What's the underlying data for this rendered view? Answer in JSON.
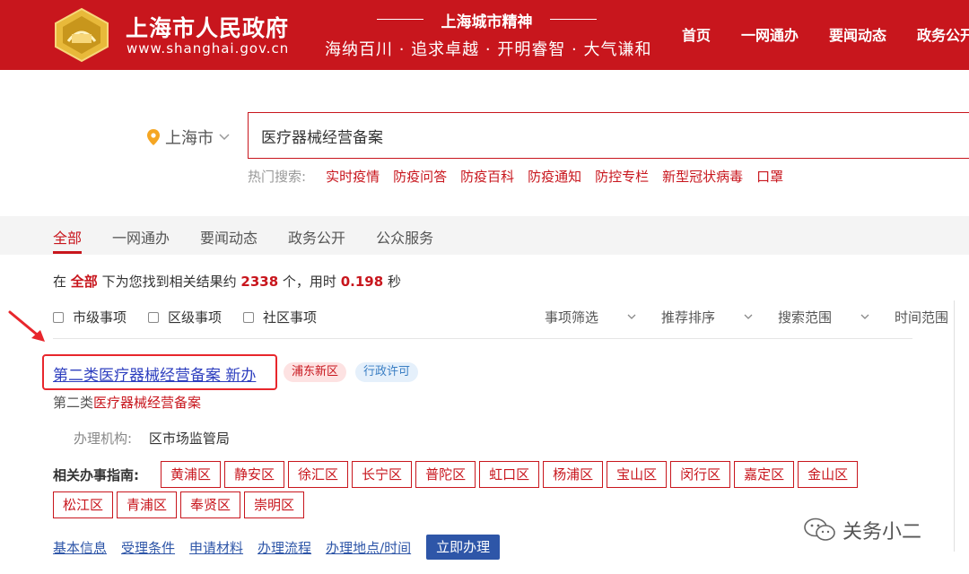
{
  "header": {
    "site_name": "上海市人民政府",
    "site_domain": "www.shanghai.gov.cn",
    "spirit_title": "上海城市精神",
    "spirit_motto": "海纳百川 · 追求卓越 · 开明睿智 · 大气谦和",
    "nav": [
      "首页",
      "一网通办",
      "要闻动态",
      "政务公开"
    ]
  },
  "search": {
    "location": "上海市",
    "query": "医疗器械经营备案",
    "hot_label": "热门搜索:",
    "hot_terms": [
      "实时疫情",
      "防疫问答",
      "防疫百科",
      "防疫通知",
      "防控专栏",
      "新型冠状病毒",
      "口罩"
    ]
  },
  "tabs": [
    "全部",
    "一网通办",
    "要闻动态",
    "政务公开",
    "公众服务"
  ],
  "stats": {
    "prefix": "在",
    "scope": "全部",
    "mid": "下为您找到相关结果约",
    "count": "2338",
    "unit": "个，用时",
    "time": "0.198",
    "suffix": "秒"
  },
  "filters": {
    "checkboxes": [
      "市级事项",
      "区级事项",
      "社区事项"
    ],
    "dropdowns": [
      "事项筛选",
      "推荐排序",
      "搜索范围",
      "时间范围"
    ]
  },
  "result": {
    "title": "第二类医疗器械经营备案 新办",
    "badge_district": "浦东新区",
    "badge_type": "行政许可",
    "subtitle_prefix": "第二类",
    "subtitle_highlight": "医疗器械经营备案",
    "agency_label": "办理机构:",
    "agency_value": "区市场监管局",
    "guide_label": "相关办事指南:",
    "guide_districts_row1": [
      "黄浦区",
      "静安区",
      "徐汇区",
      "长宁区",
      "普陀区",
      "虹口区",
      "杨浦区",
      "宝山区",
      "闵行区",
      "嘉定区",
      "金山区"
    ],
    "guide_districts_row2": [
      "松江区",
      "青浦区",
      "奉贤区",
      "崇明区"
    ],
    "links": [
      "基本信息",
      "受理条件",
      "申请材料",
      "办理流程",
      "办理地点/时间"
    ],
    "apply_label": "立即办理"
  },
  "watermark": "关务小二",
  "colors": {
    "brand_red": "#c8161d",
    "link_blue": "#2e56a8",
    "title_blue": "#2e3fbf"
  }
}
